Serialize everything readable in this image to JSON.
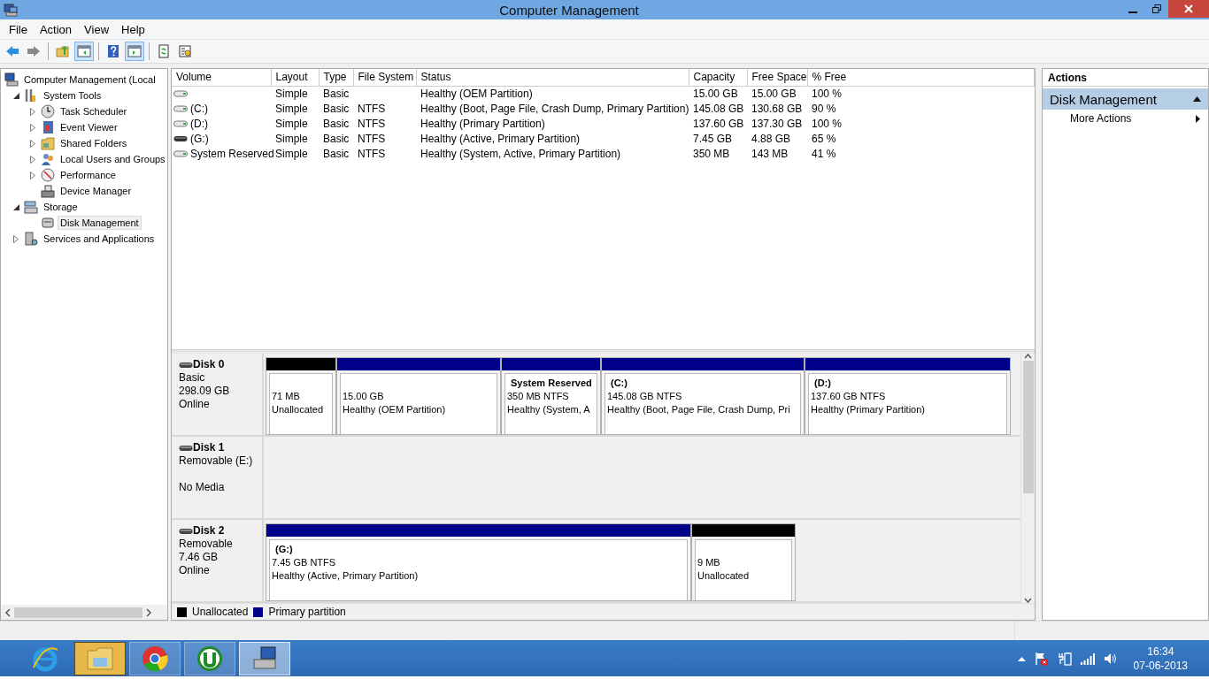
{
  "window": {
    "title": "Computer Management"
  },
  "menu": [
    "File",
    "Action",
    "View",
    "Help"
  ],
  "toolbar": [
    {
      "pressed": false
    },
    {
      "pressed": false
    },
    {
      "pressed": false
    },
    {
      "pressed": true
    },
    {
      "pressed": false
    },
    {
      "pressed": true
    },
    {
      "pressed": false
    },
    {
      "pressed": false
    }
  ],
  "tree": [
    {
      "label": "Computer Management (Local",
      "selected": false,
      "children": [
        {
          "label": "System Tools",
          "expanded": true,
          "selected": false,
          "children": [
            {
              "label": "Task Scheduler",
              "expanded": false,
              "selected": false
            },
            {
              "label": "Event Viewer",
              "expanded": false,
              "selected": false
            },
            {
              "label": "Shared Folders",
              "expanded": false,
              "selected": false
            },
            {
              "label": "Local Users and Groups",
              "expanded": false,
              "selected": false
            },
            {
              "label": "Performance",
              "expanded": false,
              "selected": false
            },
            {
              "label": "Device Manager",
              "selected": false
            }
          ]
        },
        {
          "label": "Storage",
          "expanded": true,
          "selected": false,
          "children": [
            {
              "label": "Disk Management",
              "selected": true
            }
          ]
        },
        {
          "label": "Services and Applications",
          "expanded": false,
          "selected": false
        }
      ]
    }
  ],
  "volumes": {
    "columns": [
      "Volume",
      "Layout",
      "Type",
      "File System",
      "Status",
      "Capacity",
      "Free Space",
      "% Free"
    ],
    "rows": [
      {
        "kind": "fixed",
        "cells": [
          "",
          "Simple",
          "Basic",
          "",
          "Healthy (OEM Partition)",
          "15.00 GB",
          "15.00 GB",
          "100 %"
        ]
      },
      {
        "kind": "fixed",
        "cells": [
          "(C:)",
          "Simple",
          "Basic",
          "NTFS",
          "Healthy (Boot, Page File, Crash Dump, Primary Partition)",
          "145.08 GB",
          "130.68 GB",
          "90 %"
        ]
      },
      {
        "kind": "fixed",
        "cells": [
          "(D:)",
          "Simple",
          "Basic",
          "NTFS",
          "Healthy (Primary Partition)",
          "137.60 GB",
          "137.30 GB",
          "100 %"
        ]
      },
      {
        "kind": "removable",
        "cells": [
          "(G:)",
          "Simple",
          "Basic",
          "NTFS",
          "Healthy (Active, Primary Partition)",
          "7.45 GB",
          "4.88 GB",
          "65 %"
        ]
      },
      {
        "kind": "fixed",
        "cells": [
          "System Reserved",
          "Simple",
          "Basic",
          "NTFS",
          "Healthy (System, Active, Primary Partition)",
          "350 MB",
          "143 MB",
          "41 %"
        ]
      }
    ]
  },
  "disks": [
    {
      "name": "Disk 0",
      "type": "Basic",
      "size": "298.09 GB",
      "status": "Online",
      "partitions": [
        {
          "kind": "unallocated",
          "size": "71 MB",
          "status": "Unallocated"
        },
        {
          "kind": "primary",
          "size": "15.00 GB",
          "status": "Healthy (OEM Partition)"
        },
        {
          "kind": "primary",
          "name": "System Reserved",
          "size": "350 MB NTFS",
          "status": "Healthy (System, A"
        },
        {
          "kind": "primary",
          "name": "(C:)",
          "size": "145.08 GB NTFS",
          "status": "Healthy (Boot, Page File, Crash Dump, Pri"
        },
        {
          "kind": "primary",
          "name": "(D:)",
          "size": "137.60 GB NTFS",
          "status": "Healthy (Primary Partition)"
        }
      ]
    },
    {
      "name": "Disk 1",
      "type": "Removable (E:)",
      "status": "No Media"
    },
    {
      "name": "Disk 2",
      "type": "Removable",
      "size": "7.46 GB",
      "status": "Online",
      "partitions": [
        {
          "kind": "primary",
          "name": "(G:)",
          "size": "7.45 GB NTFS",
          "status": "Healthy (Active, Primary Partition)"
        },
        {
          "kind": "unallocated",
          "size": "9 MB",
          "status": "Unallocated"
        }
      ]
    }
  ],
  "legend": [
    {
      "kind": "unallocated",
      "label": "Unallocated"
    },
    {
      "kind": "primary",
      "label": "Primary partition"
    }
  ],
  "actions": {
    "title": "Actions",
    "section": "Disk Management",
    "expanded": true,
    "items": [
      "More Actions"
    ]
  },
  "taskbar": {
    "apps": [
      {
        "kind": "browser-e",
        "running": false,
        "attention": false,
        "selected": false
      },
      {
        "kind": "folder",
        "running": true,
        "attention": true,
        "selected": false
      },
      {
        "kind": "browser-c",
        "running": true,
        "attention": false,
        "selected": false
      },
      {
        "kind": "torrent",
        "running": true,
        "attention": false,
        "selected": false
      },
      {
        "kind": "management",
        "running": true,
        "attention": false,
        "selected": true
      }
    ],
    "time": "16:34",
    "date": "07-06-2013"
  }
}
